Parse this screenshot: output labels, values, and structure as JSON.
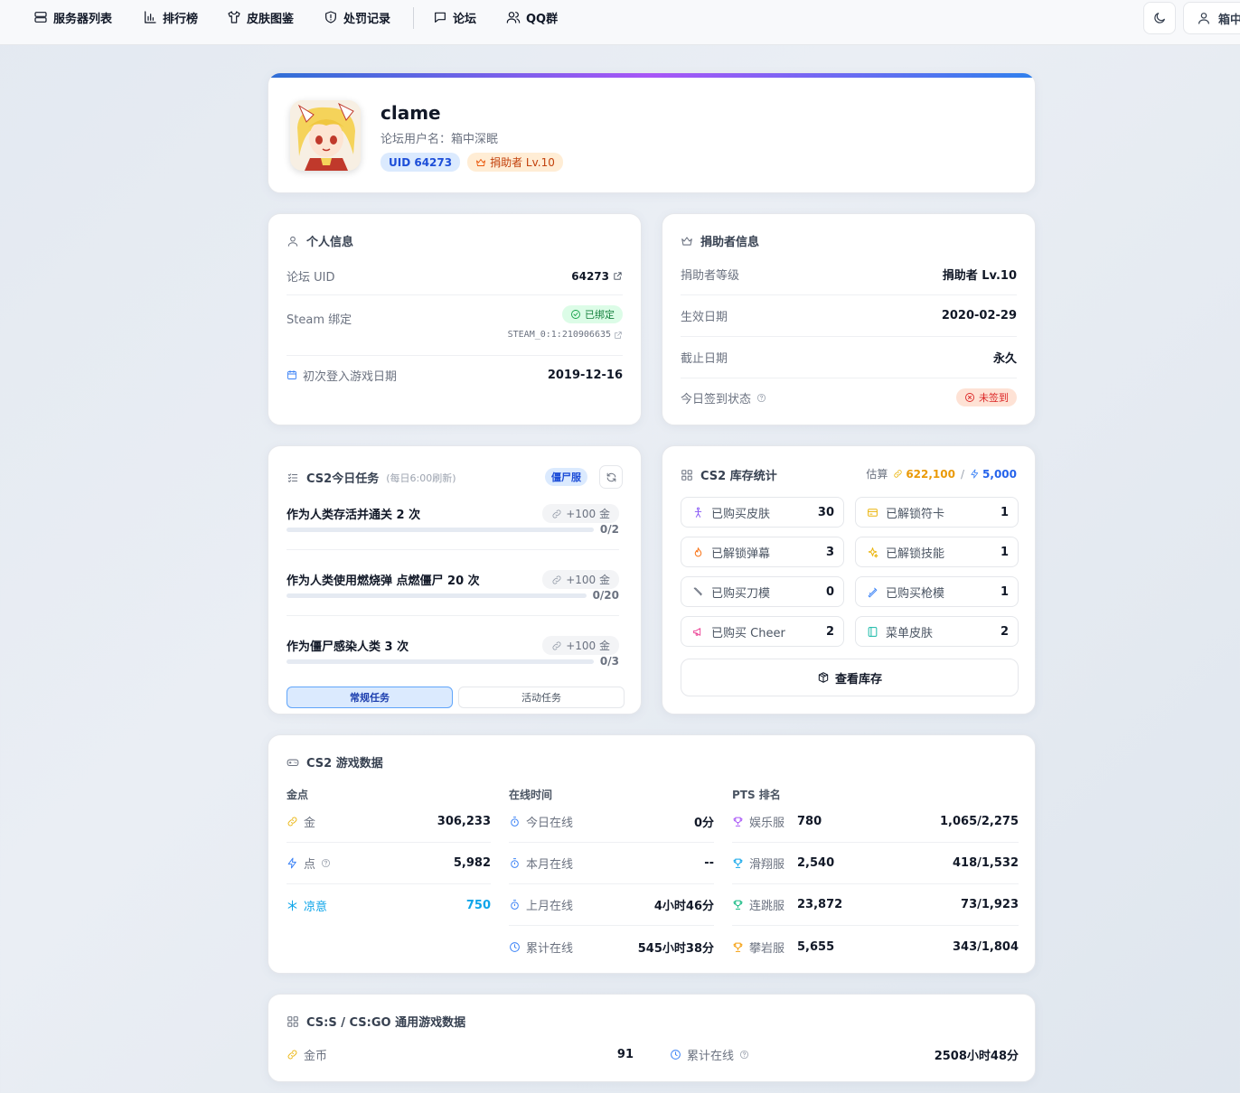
{
  "nav": {
    "items": [
      "服务器列表",
      "排行榜",
      "皮肤图鉴",
      "处罚记录",
      "论坛",
      "QQ群"
    ],
    "user_label": "箱中"
  },
  "profile": {
    "name": "clame",
    "forum_username": "论坛用户名：箱中深眠",
    "uid_badge": "UID 64273",
    "donor_badge": "捐助者 Lv.10",
    "gradient": [
      "#2f6fd6",
      "#a855f7",
      "#2f80ed"
    ]
  },
  "personal": {
    "title": "个人信息",
    "uid_label": "论坛 UID",
    "uid_value": "64273",
    "steam_label": "Steam 绑定",
    "steam_status": "已绑定",
    "steam_id": "STEAM_0:1:210906635",
    "first_login_label": "初次登入游戏日期",
    "first_login_value": "2019-12-16"
  },
  "donor": {
    "title": "捐助者信息",
    "rows": [
      {
        "label": "捐助者等级",
        "value": "捐助者 Lv.10"
      },
      {
        "label": "生效日期",
        "value": "2020-02-29"
      },
      {
        "label": "截止日期",
        "value": "永久"
      }
    ],
    "checkin_label": "今日签到状态",
    "checkin_status": "未签到"
  },
  "tasks": {
    "title": "CS2今日任务",
    "subtitle": "(每日6:00刷新)",
    "server_tag": "僵尸服",
    "items": [
      {
        "name": "作为人类存活并通关 2 次",
        "reward": "+100 金",
        "progress": "0/2",
        "fraction": 0
      },
      {
        "name": "作为人类使用燃烧弹 点燃僵尸 20 次",
        "reward": "+100 金",
        "progress": "0/20",
        "fraction": 0
      },
      {
        "name": "作为僵尸感染人类 3 次",
        "reward": "+100 金",
        "progress": "0/3",
        "fraction": 0
      }
    ],
    "tab_regular": "常规任务",
    "tab_event": "活动任务"
  },
  "inventory": {
    "title": "CS2 库存统计",
    "estimate_label": "估算",
    "estimate_gold": "622,100",
    "separator": "/",
    "estimate_points": "5,000",
    "tiles": [
      {
        "label": "已购买皮肤",
        "value": "30",
        "icon": "person-icon",
        "color": "#8b5cf6"
      },
      {
        "label": "已解锁符卡",
        "value": "1",
        "icon": "card-icon",
        "color": "#eab308"
      },
      {
        "label": "已解锁弹幕",
        "value": "3",
        "icon": "flame-icon",
        "color": "#f97316"
      },
      {
        "label": "已解锁技能",
        "value": "1",
        "icon": "sparkle-icon",
        "color": "#eab308"
      },
      {
        "label": "已购买刀模",
        "value": "0",
        "icon": "knife-icon",
        "color": "#6b7280"
      },
      {
        "label": "已购买枪模",
        "value": "1",
        "icon": "gun-icon",
        "color": "#3b82f6"
      },
      {
        "label": "已购买 Cheer",
        "value": "2",
        "icon": "megaphone-icon",
        "color": "#ec4899"
      },
      {
        "label": "菜单皮肤",
        "value": "2",
        "icon": "panel-icon",
        "color": "#14b8a6"
      }
    ],
    "view_button": "查看库存"
  },
  "gamedata": {
    "title": "CS2 游戏数据",
    "col1_title": "金点",
    "col2_title": "在线时间",
    "col3_title": "PTS 排名",
    "currency": [
      {
        "label": "金",
        "value": "306,233",
        "icon": "coin-icon",
        "color": "#eab308"
      },
      {
        "label": "点",
        "value": "5,982",
        "icon": "bolt-icon",
        "color": "#3b82f6"
      },
      {
        "label": "凉意",
        "value": "750",
        "icon": "snow-icon",
        "color": "#0ea5e9"
      }
    ],
    "online": [
      {
        "label": "今日在线",
        "value": "0分"
      },
      {
        "label": "本月在线",
        "value": "--"
      },
      {
        "label": "上月在线",
        "value": "4小时46分"
      },
      {
        "label": "累计在线",
        "value": "545小时38分"
      }
    ],
    "ranks": [
      {
        "server": "娱乐服",
        "pts": "780",
        "rank": "1,065/2,275",
        "color": "#a855f7"
      },
      {
        "server": "滑翔服",
        "pts": "2,540",
        "rank": "418/1,532",
        "color": "#0ea5e9"
      },
      {
        "server": "连跳服",
        "pts": "23,872",
        "rank": "73/1,923",
        "color": "#10b981"
      },
      {
        "server": "攀岩服",
        "pts": "5,655",
        "rank": "343/1,804",
        "color": "#f59e0b"
      }
    ]
  },
  "csgo": {
    "title": "CS:S / CS:GO 通用游戏数据",
    "coin_label": "金币",
    "coin_value": "91",
    "online_label": "累计在线",
    "online_value": "2508小时48分"
  }
}
